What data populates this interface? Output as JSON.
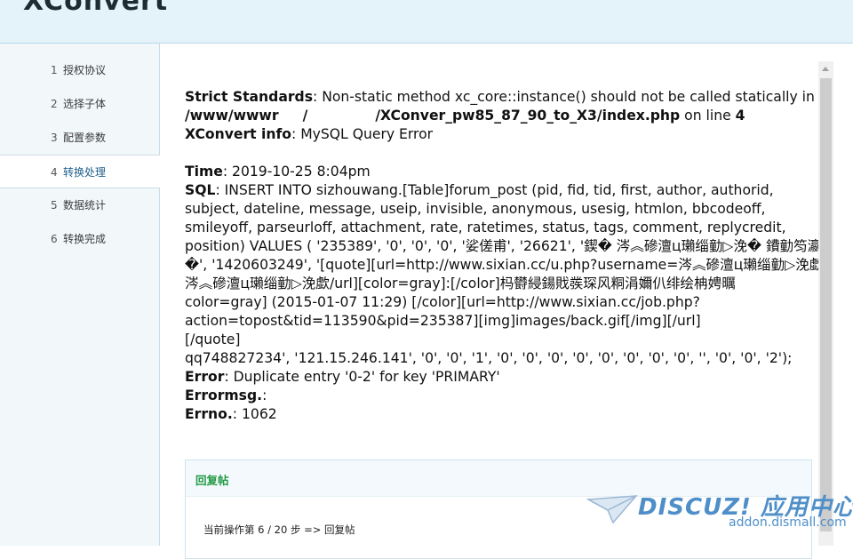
{
  "header": {
    "logo": "XConvert"
  },
  "sidebar": {
    "items": [
      {
        "num": "1",
        "label": "授权协议",
        "active": false
      },
      {
        "num": "2",
        "label": "选择子体",
        "active": false
      },
      {
        "num": "3",
        "label": "配置参数",
        "active": false
      },
      {
        "num": "4",
        "label": "转换处理",
        "active": true
      },
      {
        "num": "5",
        "label": "数据统计",
        "active": false
      },
      {
        "num": "6",
        "label": "转换完成",
        "active": false
      }
    ]
  },
  "content": {
    "strict_label": "Strict Standards",
    "strict_text": ": Non-static method xc_core::instance() should not be called statically in",
    "strict_path": "/www/wwwr     /              /XConver_pw85_87_90_to_X3/index.php",
    "strict_online": " on line ",
    "strict_line": "4",
    "info_label": "XConvert info",
    "info_text": ": MySQL Query Error",
    "time_label": "Time",
    "time_text": ": 2019-10-25 8:04pm",
    "sql_label": "SQL",
    "sql_lines": [
      ": INSERT INTO sizhouwang.[Table]forum_post (pid, fid, tid, first, author, authorid,",
      "subject, dateline, message, useip, invisible, anonymous, usesig, htmlon, bbcodeoff,",
      "smileyoff, parseurloff, attachment, rate, ratetimes, status, tags, comment, replycredit,",
      "position) VALUES ( '235389', '0', '0', '0', '娑傞甫', '26621', '鍥� 涔︽磣澶ц瓎缁勭▷浼� 鐨勭笉瀛",
      "�', '1420603249', '[quote][url=http://www.sixian.cc/u.php?username=涔︽磣澶ц瓎缁勭▷浼歔",
      "涔︽磣澶ц瓎缁勭▷浼歔/url][color=gray]:[/color]杩欎綅鍚戝彂琛风粡涓嬭仈绯绘柟娉曞",
      "color=gray] (2015-01-07 11:29) [/color][url=http://www.sixian.cc/job.php?",
      "action=topost&tid=113590&pid=235387][img]images/back.gif[/img][/url]",
      "[/quote]",
      "qq748827234', '121.15.246.141', '0', '0', '1', '0', '0', '0', '0', '0', '0', '0', '0', '', '0', '0', '2');"
    ],
    "error_label": "Error",
    "error_text": ": Duplicate entry '0-2' for key 'PRIMARY'",
    "errormsg_label": "Errormsg.",
    "errormsg_text": ":",
    "errno_label": "Errno.",
    "errno_text": ": 1062"
  },
  "panel": {
    "title": "回复帖",
    "status": "当前操作第 6 / 20 步 => 回复帖"
  },
  "watermark": {
    "title": "DISCUZ! 应用中心",
    "subtitle": "addon.dismall.com"
  }
}
